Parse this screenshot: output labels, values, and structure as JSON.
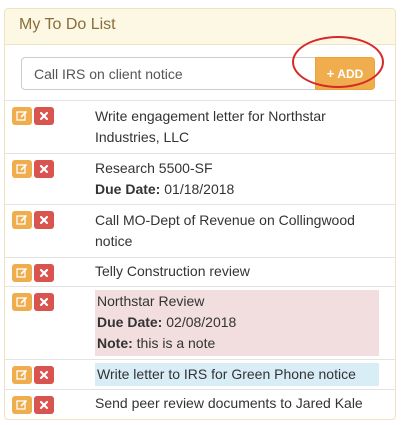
{
  "panel": {
    "title": "My To Do List"
  },
  "new_todo": {
    "value": "Call IRS on client notice",
    "add_label": "ADD",
    "add_icon": "plus-icon"
  },
  "labels": {
    "due_date": "Due Date:",
    "note": "Note:"
  },
  "items": [
    {
      "lines": [
        "Write engagement letter for Northstar",
        "Industries, LLC"
      ]
    },
    {
      "lines": [
        "Research 5500-SF"
      ],
      "due_date": "01/18/2018"
    },
    {
      "lines": [
        "Call MO-Dept of Revenue on Collingwood",
        "notice"
      ]
    },
    {
      "lines": [
        "Telly Construction review"
      ]
    },
    {
      "lines": [
        "Northstar Review"
      ],
      "due_date": "02/08/2018",
      "note": "this is a note",
      "highlight": "red"
    },
    {
      "lines": [
        "Write letter to IRS for Green Phone notice"
      ],
      "highlight": "blue"
    },
    {
      "lines": [
        "Send peer review documents to Jared Kale"
      ]
    }
  ],
  "colors": {
    "header_bg": "#fcf8e3",
    "header_text": "#8a6d3b",
    "edit_button": "#f0ad4e",
    "delete_button": "#d9534f",
    "highlight_red": "#f2dede",
    "highlight_blue": "#d9edf7",
    "annotation": "#d42a2a"
  }
}
